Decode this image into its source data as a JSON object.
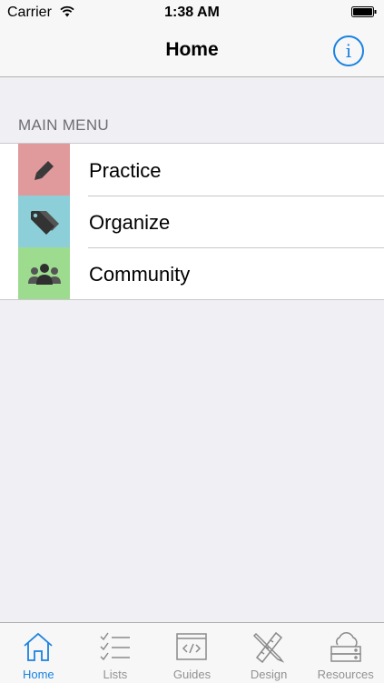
{
  "status_bar": {
    "carrier": "Carrier",
    "time": "1:38 AM",
    "wifi_icon": "wifi-icon",
    "battery_icon": "battery-icon"
  },
  "nav": {
    "title": "Home",
    "info_label": "i",
    "info_icon": "info-icon",
    "accent_color": "#1a82e2"
  },
  "section": {
    "header": "MAIN MENU"
  },
  "menu": [
    {
      "label": "Practice",
      "icon": "pencil-icon",
      "color": "#e09a9c"
    },
    {
      "label": "Organize",
      "icon": "tag-icon",
      "color": "#8ccfd9"
    },
    {
      "label": "Community",
      "icon": "people-icon",
      "color": "#9ddc8f"
    }
  ],
  "tabs": [
    {
      "label": "Home",
      "icon": "house-icon",
      "active": true
    },
    {
      "label": "Lists",
      "icon": "checklist-icon",
      "active": false
    },
    {
      "label": "Guides",
      "icon": "code-window-icon",
      "active": false
    },
    {
      "label": "Design",
      "icon": "pencil-ruler-icon",
      "active": false
    },
    {
      "label": "Resources",
      "icon": "cloud-drive-icon",
      "active": false
    }
  ]
}
